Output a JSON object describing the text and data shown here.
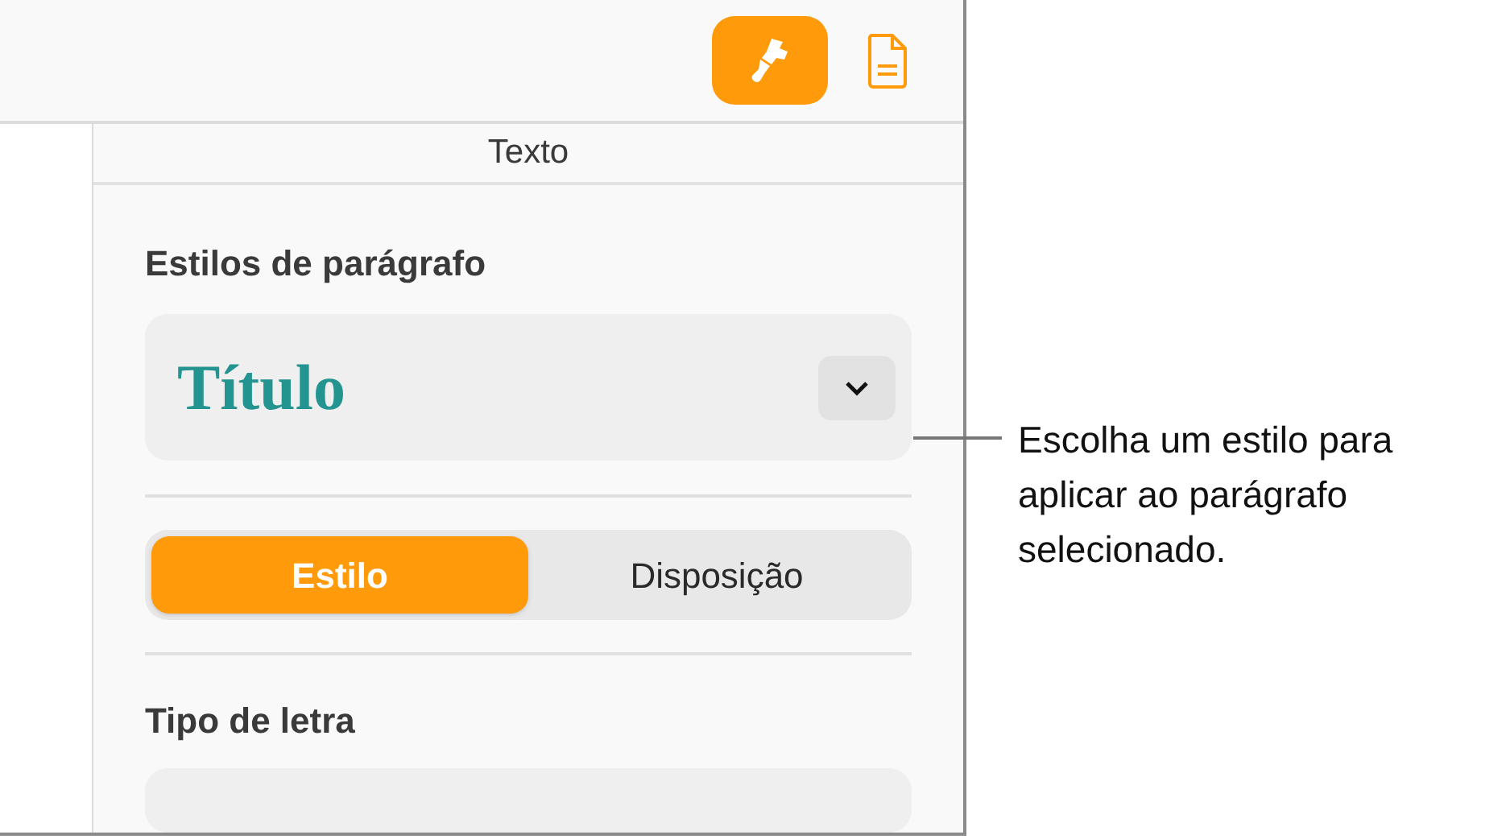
{
  "toolbar": {
    "buttons": [
      {
        "kind": "format",
        "selected": true
      },
      {
        "kind": "document",
        "selected": false
      }
    ]
  },
  "panel": {
    "title": "Texto",
    "section_label": "Estilos de parágrafo",
    "style_popup": {
      "value": "Título"
    },
    "segments": [
      {
        "label": "Estilo",
        "selected": true
      },
      {
        "label": "Disposição",
        "selected": false
      }
    ],
    "font_label": "Tipo de letra"
  },
  "callout": "Escolha um estilo para aplicar ao parágrafo selecionado."
}
